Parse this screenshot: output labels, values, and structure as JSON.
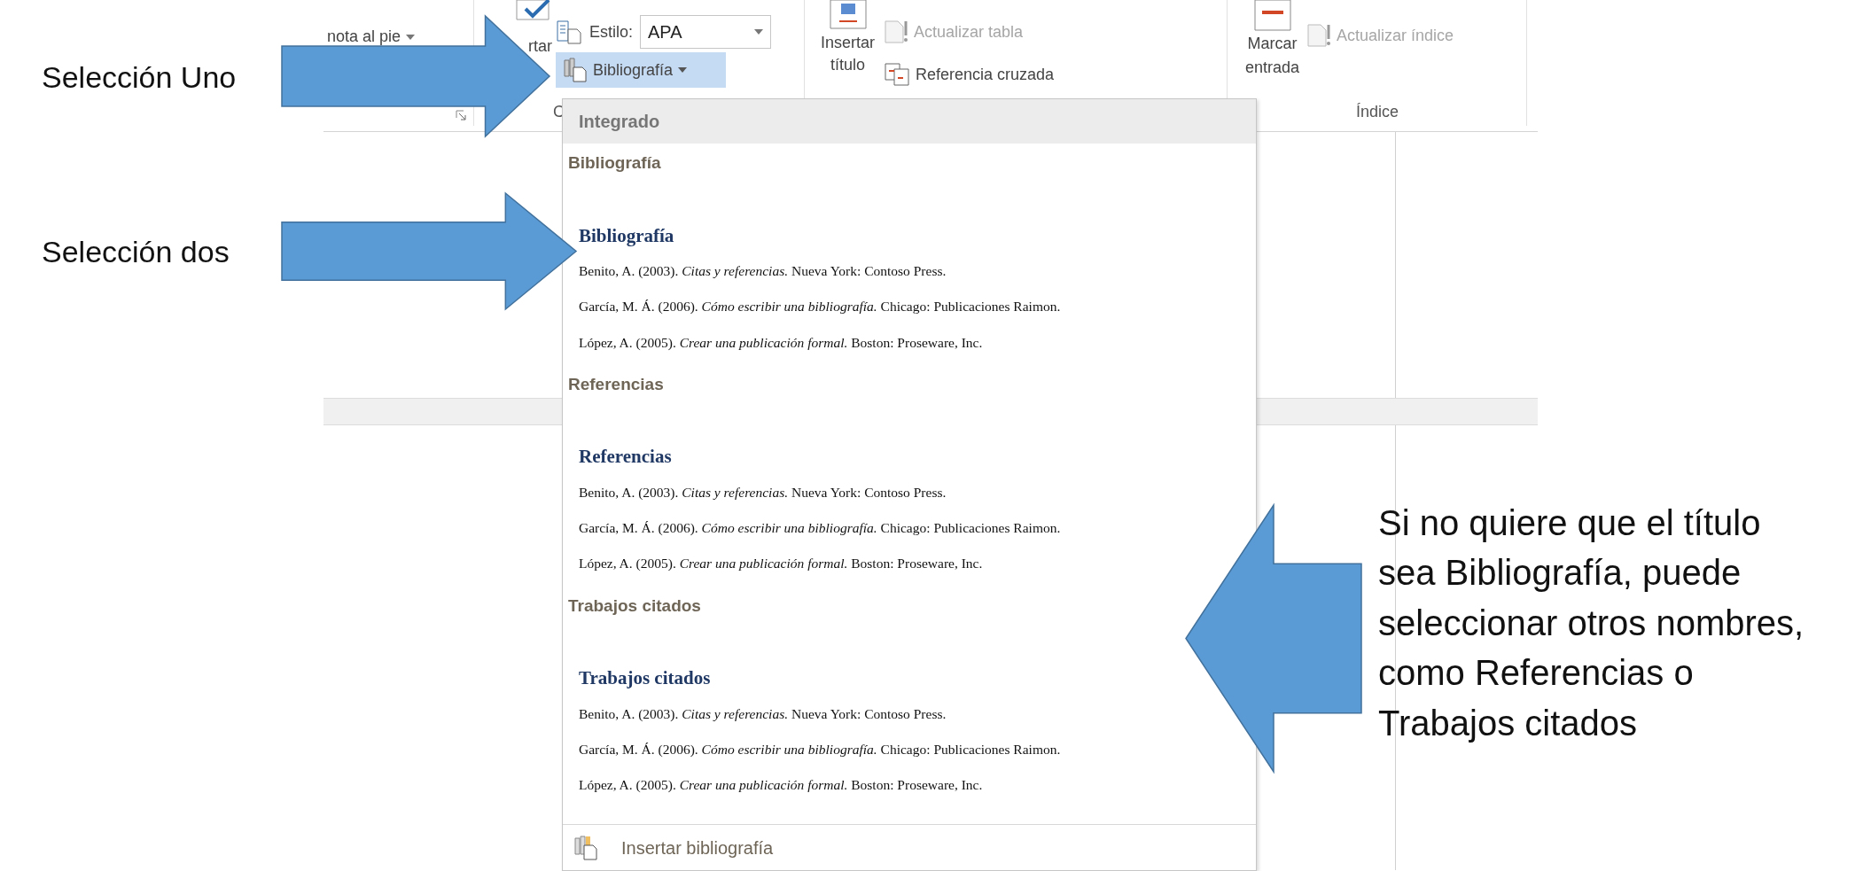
{
  "ribbon": {
    "footnote_dropdown": {
      "label": "nota al pie"
    },
    "citations_group": {
      "insert_label": "rtar",
      "group_label": "C",
      "style": {
        "label": "Estilo:",
        "value": "APA"
      },
      "bibliography_button": {
        "label": "Bibliografía",
        "expanded": true
      }
    },
    "captions_group": {
      "insert_caption": [
        "Insertar",
        "título"
      ],
      "update_table": {
        "label": "Actualizar tabla",
        "disabled": true
      },
      "cross_reference": {
        "label": "Referencia cruzada",
        "disabled": false
      }
    },
    "index_group": {
      "mark_entry": [
        "Marcar",
        "entrada"
      ],
      "update_index": {
        "label": "Actualizar índice",
        "disabled": true
      },
      "group_label": "Índice"
    }
  },
  "bibliography_menu": {
    "header": "Integrado",
    "gallery": [
      {
        "label": "Bibliografía",
        "heading": "Bibliografía",
        "entries": [
          "Benito, A. (2003). *Citas y referencias.* Nueva York: Contoso Press.",
          "García, M. Á. (2006). *Cómo escribir una bibliografía.* Chicago: Publicaciones Raimon.",
          "López, A. (2005). *Crear una publicación formal.* Boston: Proseware, Inc."
        ]
      },
      {
        "label": "Referencias",
        "heading": "Referencias",
        "entries": [
          "Benito, A. (2003). *Citas y referencias.* Nueva York: Contoso Press.",
          "García, M. Á. (2006). *Cómo escribir una bibliografía.* Chicago: Publicaciones Raimon.",
          "López, A. (2005). *Crear una publicación formal.* Boston: Proseware, Inc."
        ]
      },
      {
        "label": "Trabajos citados",
        "heading": "Trabajos citados",
        "entries": [
          "Benito, A. (2003). *Citas y referencias.* Nueva York: Contoso Press.",
          "García, M. Á. (2006). *Cómo escribir una bibliografía.* Chicago: Publicaciones Raimon.",
          "López, A. (2005). *Crear una publicación formal.* Boston: Proseware, Inc."
        ]
      }
    ],
    "footer": {
      "label": "Insertar bibliografía"
    }
  },
  "annotations": [
    {
      "text": "Selección Uno",
      "kind": "right"
    },
    {
      "text": "Selección dos",
      "kind": "right"
    },
    {
      "text": "Si no quiere que el título sea Bibliografía, puede seleccionar otros nombres, como Referencias o Trabajos citados",
      "kind": "left"
    }
  ]
}
